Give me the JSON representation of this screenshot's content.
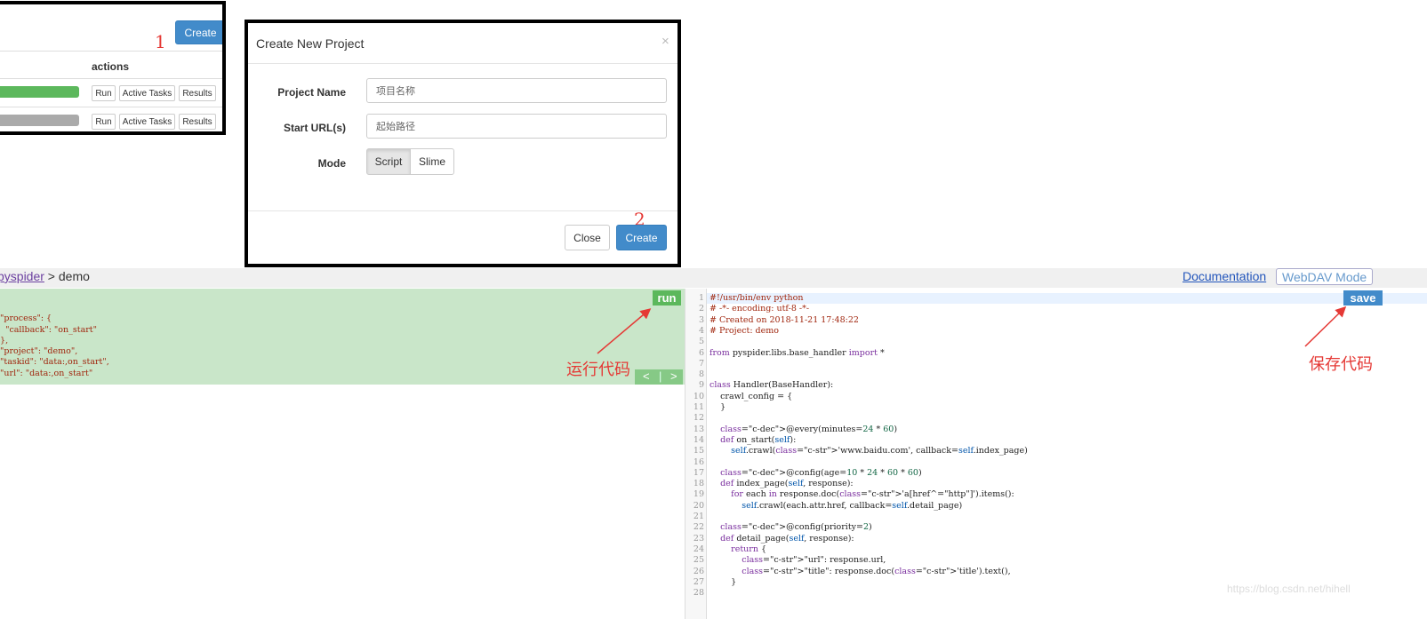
{
  "project_list": {
    "create_label": "Create",
    "marker": "1",
    "column_header": "actions",
    "rows": [
      {
        "progress_color": "#5cb85c",
        "run": "Run",
        "active": "Active Tasks",
        "results": "Results"
      },
      {
        "progress_color": "#aaaaaa",
        "run": "Run",
        "active": "Active Tasks",
        "results": "Results"
      }
    ]
  },
  "modal": {
    "title": "Create New Project",
    "close_icon": "×",
    "project_name_label": "Project Name",
    "project_name_placeholder": "项目名称",
    "start_url_label": "Start URL(s)",
    "start_url_placeholder": "起始路径",
    "mode_label": "Mode",
    "mode_options": [
      "Script",
      "Slime"
    ],
    "close_label": "Close",
    "create_label": "Create",
    "marker": "2"
  },
  "debug": {
    "breadcrumb_link": "pyspider",
    "breadcrumb_sep": " > ",
    "breadcrumb_current": "demo",
    "doc_link": "Documentation",
    "webdav": "WebDAV Mode",
    "run_label": "run",
    "save_label": "save",
    "prev": "<",
    "next": ">",
    "run_annotation": "运行代码",
    "save_annotation": "保存代码",
    "task_json": "{\n  \"process\": {\n    \"callback\": \"on_start\"\n  },\n  \"project\": \"demo\",\n  \"taskid\": \"data:,on_start\",\n  \"url\": \"data:,on_start\"\n}",
    "code_lines": [
      "#!/usr/bin/env python",
      "# -*- encoding: utf-8 -*-",
      "# Created on 2018-11-21 17:48:22",
      "# Project: demo",
      "",
      "from pyspider.libs.base_handler import *",
      "",
      "",
      "class Handler(BaseHandler):",
      "    crawl_config = {",
      "    }",
      "",
      "    @every(minutes=24 * 60)",
      "    def on_start(self):",
      "        self.crawl('www.baidu.com', callback=self.index_page)",
      "",
      "    @config(age=10 * 24 * 60 * 60)",
      "    def index_page(self, response):",
      "        for each in response.doc('a[href^=\"http\"]').items():",
      "            self.crawl(each.attr.href, callback=self.detail_page)",
      "",
      "    @config(priority=2)",
      "    def detail_page(self, response):",
      "        return {",
      "            \"url\": response.url,",
      "            \"title\": response.doc('title').text(),",
      "        }",
      ""
    ]
  },
  "watermark": "https://blog.csdn.net/hihell",
  "colors": {
    "primary": "#428bca",
    "success": "#5cb85c",
    "annotation": "#e53935"
  }
}
